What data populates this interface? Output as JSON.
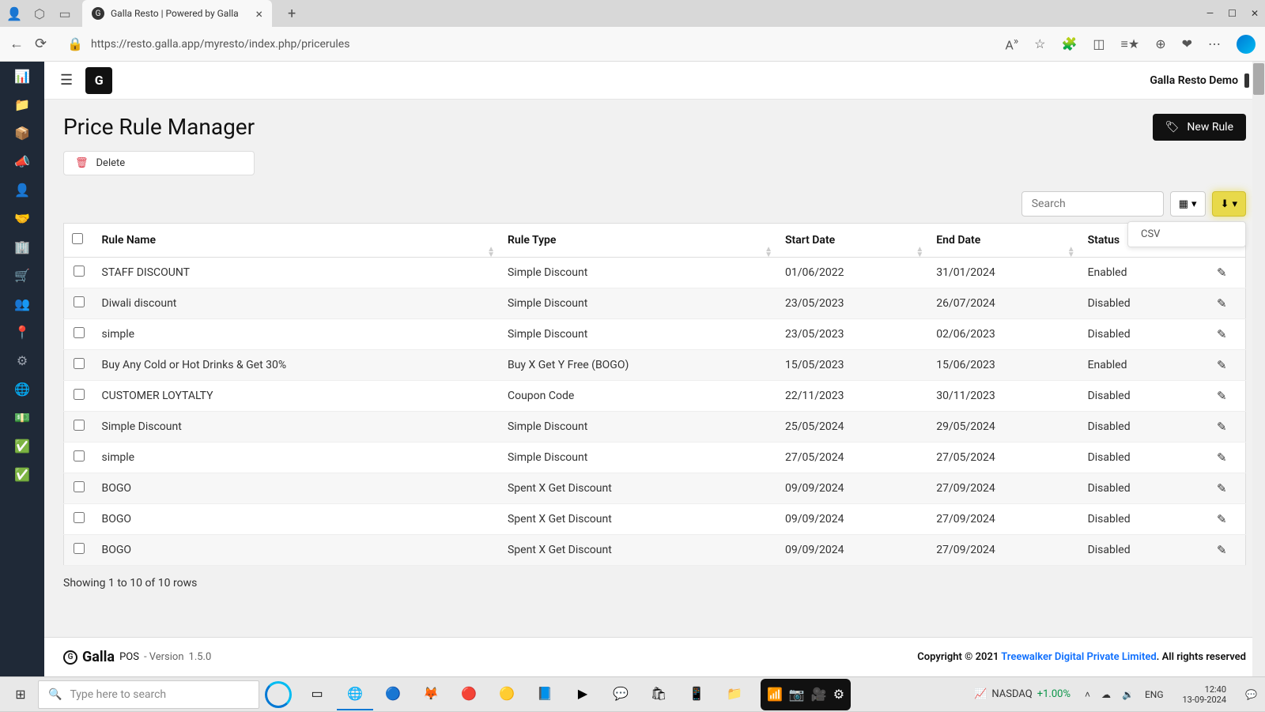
{
  "browser": {
    "tab_title": "Galla Resto | Powered by Galla",
    "url": "https://resto.galla.app/myresto/index.php/pricerules"
  },
  "app": {
    "user_label": "Galla Resto Demo",
    "page_title": "Price Rule Manager",
    "delete_label": "Delete",
    "new_rule_label": "New Rule",
    "search_placeholder": "Search",
    "export_option": "CSV",
    "table_footer": "Showing 1 to 10 of 10 rows"
  },
  "columns": {
    "rule_name": "Rule Name",
    "rule_type": "Rule Type",
    "start_date": "Start Date",
    "end_date": "End Date",
    "status": "Status"
  },
  "rows": [
    {
      "name": "STAFF DISCOUNT",
      "type": "Simple Discount",
      "start": "01/06/2022",
      "end": "31/01/2024",
      "status": "Enabled"
    },
    {
      "name": "Diwali discount",
      "type": "Simple Discount",
      "start": "23/05/2023",
      "end": "26/07/2024",
      "status": "Disabled"
    },
    {
      "name": "simple",
      "type": "Simple Discount",
      "start": "23/05/2023",
      "end": "02/06/2023",
      "status": "Disabled"
    },
    {
      "name": "Buy Any Cold or Hot Drinks & Get 30%",
      "type": "Buy X Get Y Free (BOGO)",
      "start": "15/05/2023",
      "end": "15/06/2023",
      "status": "Enabled"
    },
    {
      "name": "CUSTOMER LOYTALTY",
      "type": "Coupon Code",
      "start": "22/11/2023",
      "end": "30/11/2023",
      "status": "Disabled"
    },
    {
      "name": "Simple Discount",
      "type": "Simple Discount",
      "start": "25/05/2024",
      "end": "29/05/2024",
      "status": "Disabled"
    },
    {
      "name": "simple",
      "type": "Simple Discount",
      "start": "27/05/2024",
      "end": "27/05/2024",
      "status": "Disabled"
    },
    {
      "name": "BOGO",
      "type": "Spent X Get Discount",
      "start": "09/09/2024",
      "end": "27/09/2024",
      "status": "Disabled"
    },
    {
      "name": "BOGO",
      "type": "Spent X Get Discount",
      "start": "09/09/2024",
      "end": "27/09/2024",
      "status": "Disabled"
    },
    {
      "name": "BOGO",
      "type": "Spent X Get Discount",
      "start": "09/09/2024",
      "end": "27/09/2024",
      "status": "Disabled"
    }
  ],
  "footer": {
    "brand": "Galla",
    "pos": "POS",
    "version_label": "- Version",
    "version": "1.5.0",
    "copyright_prefix": "Copyright © 2021",
    "company": "Treewalker Digital Private Limited",
    "rights": ". All rights reserved"
  },
  "taskbar": {
    "search_placeholder": "Type here to search",
    "stock_name": "NASDAQ",
    "stock_change": "+1.00%",
    "lang": "ENG",
    "time": "12:40",
    "date": "13-09-2024"
  }
}
